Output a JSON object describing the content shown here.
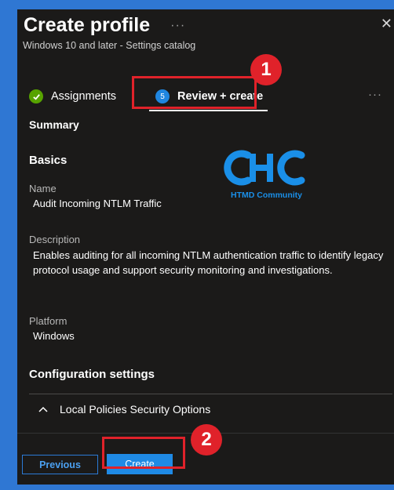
{
  "header": {
    "title": "Create profile",
    "more": "···",
    "subtitle": "Windows 10 and later - Settings catalog",
    "close": "✕"
  },
  "steps": {
    "done_label": "Assignments",
    "current_number": "5",
    "current_label": "Review + create",
    "more": "···"
  },
  "annotations": {
    "badge1": "1",
    "badge2": "2",
    "accent": "#e0222a"
  },
  "summary": {
    "heading": "Summary",
    "basics_heading": "Basics",
    "name_label": "Name",
    "name_value": "Audit Incoming NTLM Traffic",
    "description_label": "Description",
    "description_value": "Enables auditing for all incoming NTLM authentication traffic to identify legacy protocol usage and support security monitoring and investigations.",
    "platform_label": "Platform",
    "platform_value": "Windows",
    "config_heading": "Configuration settings",
    "accordion_label": "Local Policies Security Options"
  },
  "watermark": {
    "text": "HTMD Community"
  },
  "footer": {
    "previous_label": "Previous",
    "create_label": "Create"
  }
}
